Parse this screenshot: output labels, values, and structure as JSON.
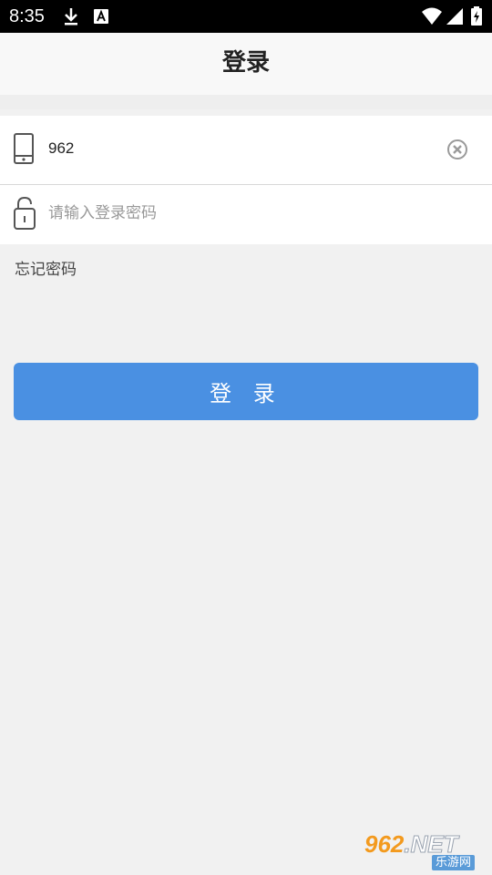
{
  "status_bar": {
    "time": "8:35",
    "icons": [
      "download-icon",
      "font-a-icon",
      "wifi-icon",
      "signal-icon",
      "battery-charging-icon"
    ]
  },
  "header": {
    "title": "登录"
  },
  "form": {
    "phone_value": "962",
    "phone_icon": "phone-icon",
    "clear_icon": "clear-icon",
    "lock_icon": "unlock-icon",
    "password_placeholder": "请输入登录密码"
  },
  "forgot_password": "忘记密码",
  "login_button": "登 录",
  "watermark": {
    "brand_num": "962",
    "brand_net": ".NET",
    "sub": "乐游网"
  },
  "colors": {
    "primary": "#4a90e2",
    "background": "#f1f1f1"
  }
}
